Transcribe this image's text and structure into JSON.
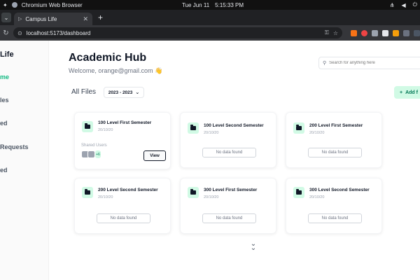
{
  "os": {
    "app_name": "Chromium Web Browser",
    "date": "Tue Jun 11",
    "time": "5:15:33 PM"
  },
  "browser": {
    "tab_title": "Campus Life",
    "url": "localhost:5173/dashboard"
  },
  "sidebar": {
    "brand": "Life",
    "items": [
      {
        "label": "me",
        "active": true
      },
      {
        "label": "les",
        "active": false
      },
      {
        "label": "ed",
        "active": false
      },
      {
        "label": "Requests",
        "active": false
      },
      {
        "label": "ed",
        "active": false
      }
    ]
  },
  "header": {
    "title": "Academic Hub",
    "welcome": "Welcome, orange@gmail.com 👋",
    "search_placeholder": "Search for anything here"
  },
  "files": {
    "label": "All Files",
    "year": "2023 - 2023",
    "add_label": "Add f"
  },
  "cards": [
    {
      "title": "100 Level First Semester",
      "date": "20/10/20",
      "shared_label": "Shared Users",
      "more": "+6",
      "view_label": "View"
    },
    {
      "title": "100 Level Second Semester",
      "date": "20/10/20",
      "empty_label": "No data found"
    },
    {
      "title": "200 Level First Semester",
      "date": "20/10/20",
      "empty_label": "No data found"
    },
    {
      "title": "200 Level Second Semester",
      "date": "20/10/20",
      "empty_label": "No data found"
    },
    {
      "title": "300 Level First Semester",
      "date": "20/10/20",
      "empty_label": "No data found"
    },
    {
      "title": "300 Level Second Semester",
      "date": "20/10/20",
      "empty_label": "No data found"
    }
  ],
  "colors": {
    "accent": "#10b981",
    "accent_light": "#d1fae5"
  }
}
